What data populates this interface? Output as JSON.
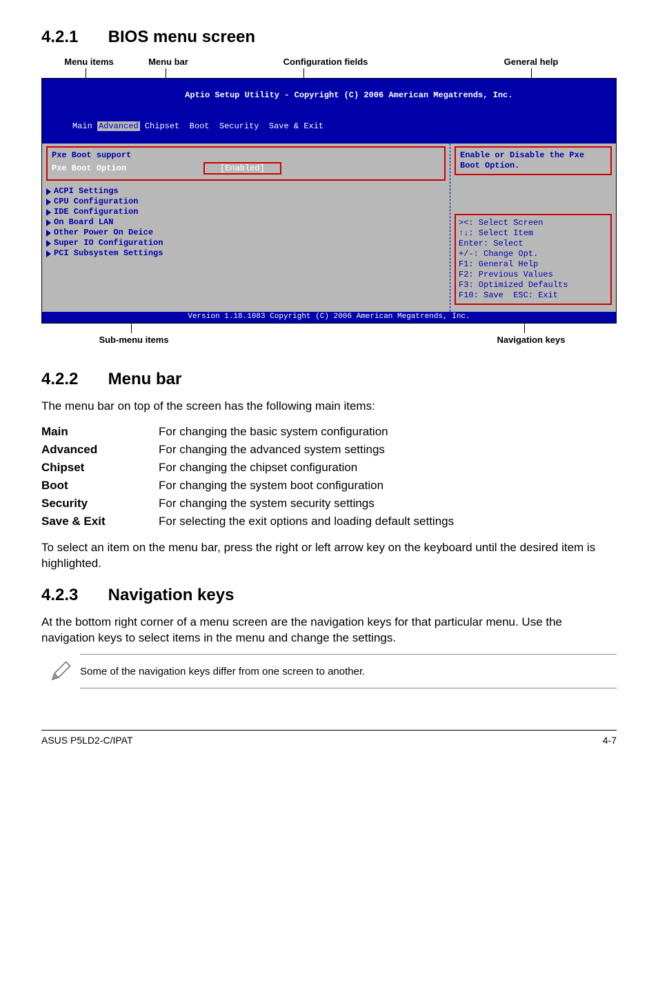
{
  "sections": {
    "s1": {
      "num": "4.2.1",
      "title": "BIOS menu screen"
    },
    "s2": {
      "num": "4.2.2",
      "title": "Menu bar"
    },
    "s3": {
      "num": "4.2.3",
      "title": "Navigation keys"
    }
  },
  "annotations": {
    "top": {
      "menu_items": "Menu items",
      "menu_bar": "Menu bar",
      "config_fields": "Configuration fields",
      "general_help": "General help"
    },
    "bottom": {
      "sub_menu": "Sub-menu items",
      "nav_keys": "Navigation keys"
    }
  },
  "bios": {
    "header": "Aptio Setup Utility - Copyright (C) 2006 American Megatrends, Inc.",
    "tabs": [
      "Main",
      "Advanced",
      "Chipset",
      "Boot",
      "Security",
      "Save & Exit"
    ],
    "selected_tab": "Advanced",
    "pxe": {
      "support_label": "Pxe Boot support",
      "option_label": "Pxe Boot Option",
      "option_value": "[Enabled]"
    },
    "submenu": [
      "ACPI Settings",
      "CPU Configuration",
      "IDE Configuration",
      "On Board LAN",
      "Other Power On Deice",
      "Super IO Configuration",
      "PCI Subsystem Settings"
    ],
    "help_text": "Enable or Disable the Pxe Boot Option.",
    "nav_keys_text": "><: Select Screen\n↑↓: Select Item\nEnter: Select\n+/-: Change Opt.\nF1: General Help\nF2: Previous Values\nF3: Optimized Defaults\nF10: Save  ESC: Exit",
    "footer": "Version 1.18.1083 Copyright (C) 2006 American Megatrends, Inc."
  },
  "menu_bar_section": {
    "intro": "The menu bar on top of the screen has the following main items:",
    "rows": [
      {
        "k": "Main",
        "v": "For changing the basic system configuration"
      },
      {
        "k": "Advanced",
        "v": "For changing the advanced system settings"
      },
      {
        "k": "Chipset",
        "v": "For changing the chipset configuration"
      },
      {
        "k": "Boot",
        "v": "For changing the system boot configuration"
      },
      {
        "k": "Security",
        "v": "For changing the system security settings"
      },
      {
        "k": "Save & Exit",
        "v": "For selecting the exit options and loading default settings"
      }
    ],
    "outro": "To select an item on the menu bar, press the right or left arrow key on the keyboard until the desired item is highlighted."
  },
  "nav_keys_section": {
    "text": "At the bottom right corner of a menu screen are the navigation keys for that particular menu. Use the navigation keys to select items in the menu and change the settings.",
    "note": "Some of the navigation keys differ from one screen to another."
  },
  "footer": {
    "left": "ASUS P5LD2-C/IPAT",
    "right": "4-7"
  }
}
